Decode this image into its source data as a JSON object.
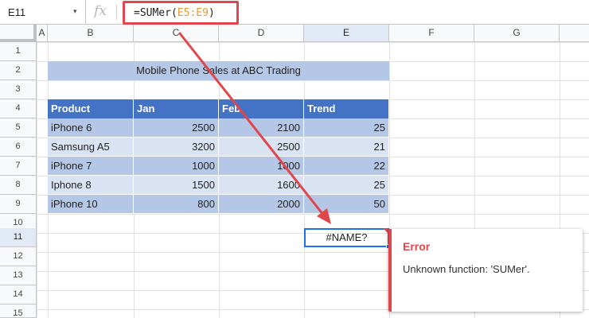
{
  "formula_bar": {
    "name_box": "E11",
    "dropdown_glyph": "▾",
    "fx_label": "fx",
    "formula_prefix": "=SUMer(",
    "formula_ref": "E5:E9",
    "formula_suffix": ")"
  },
  "columns": [
    "A",
    "B",
    "C",
    "D",
    "E",
    "F",
    "G"
  ],
  "rows": [
    "1",
    "2",
    "3",
    "4",
    "5",
    "6",
    "7",
    "8",
    "9",
    "10",
    "11",
    "12",
    "13",
    "14",
    "15"
  ],
  "selected_column": "E",
  "selected_row": "11",
  "table": {
    "title": "Mobile Phone Sales at ABC Trading",
    "headers": [
      "Product",
      "Jan",
      "Feb",
      "Trend"
    ],
    "data": [
      [
        "iPhone 6",
        "2500",
        "2100",
        "25"
      ],
      [
        "Samsung A5",
        "3200",
        "2500",
        "21"
      ],
      [
        "iPhone 7",
        "1000",
        "1000",
        "22"
      ],
      [
        "Iphone 8",
        "1500",
        "1600",
        "25"
      ],
      [
        "iPhone 10",
        "800",
        "2000",
        "50"
      ]
    ]
  },
  "active_cell": {
    "address": "E11",
    "value": "#NAME?"
  },
  "error_tooltip": {
    "title": "Error",
    "message": "Unknown function: 'SUMer'."
  },
  "colors": {
    "accent_red": "#e0474c",
    "header_blue": "#4472c4",
    "row_dark": "#b4c7e7",
    "row_light": "#dae3f3",
    "selection_blue": "#1a73e8",
    "range_ref_orange": "#e59a3a"
  }
}
